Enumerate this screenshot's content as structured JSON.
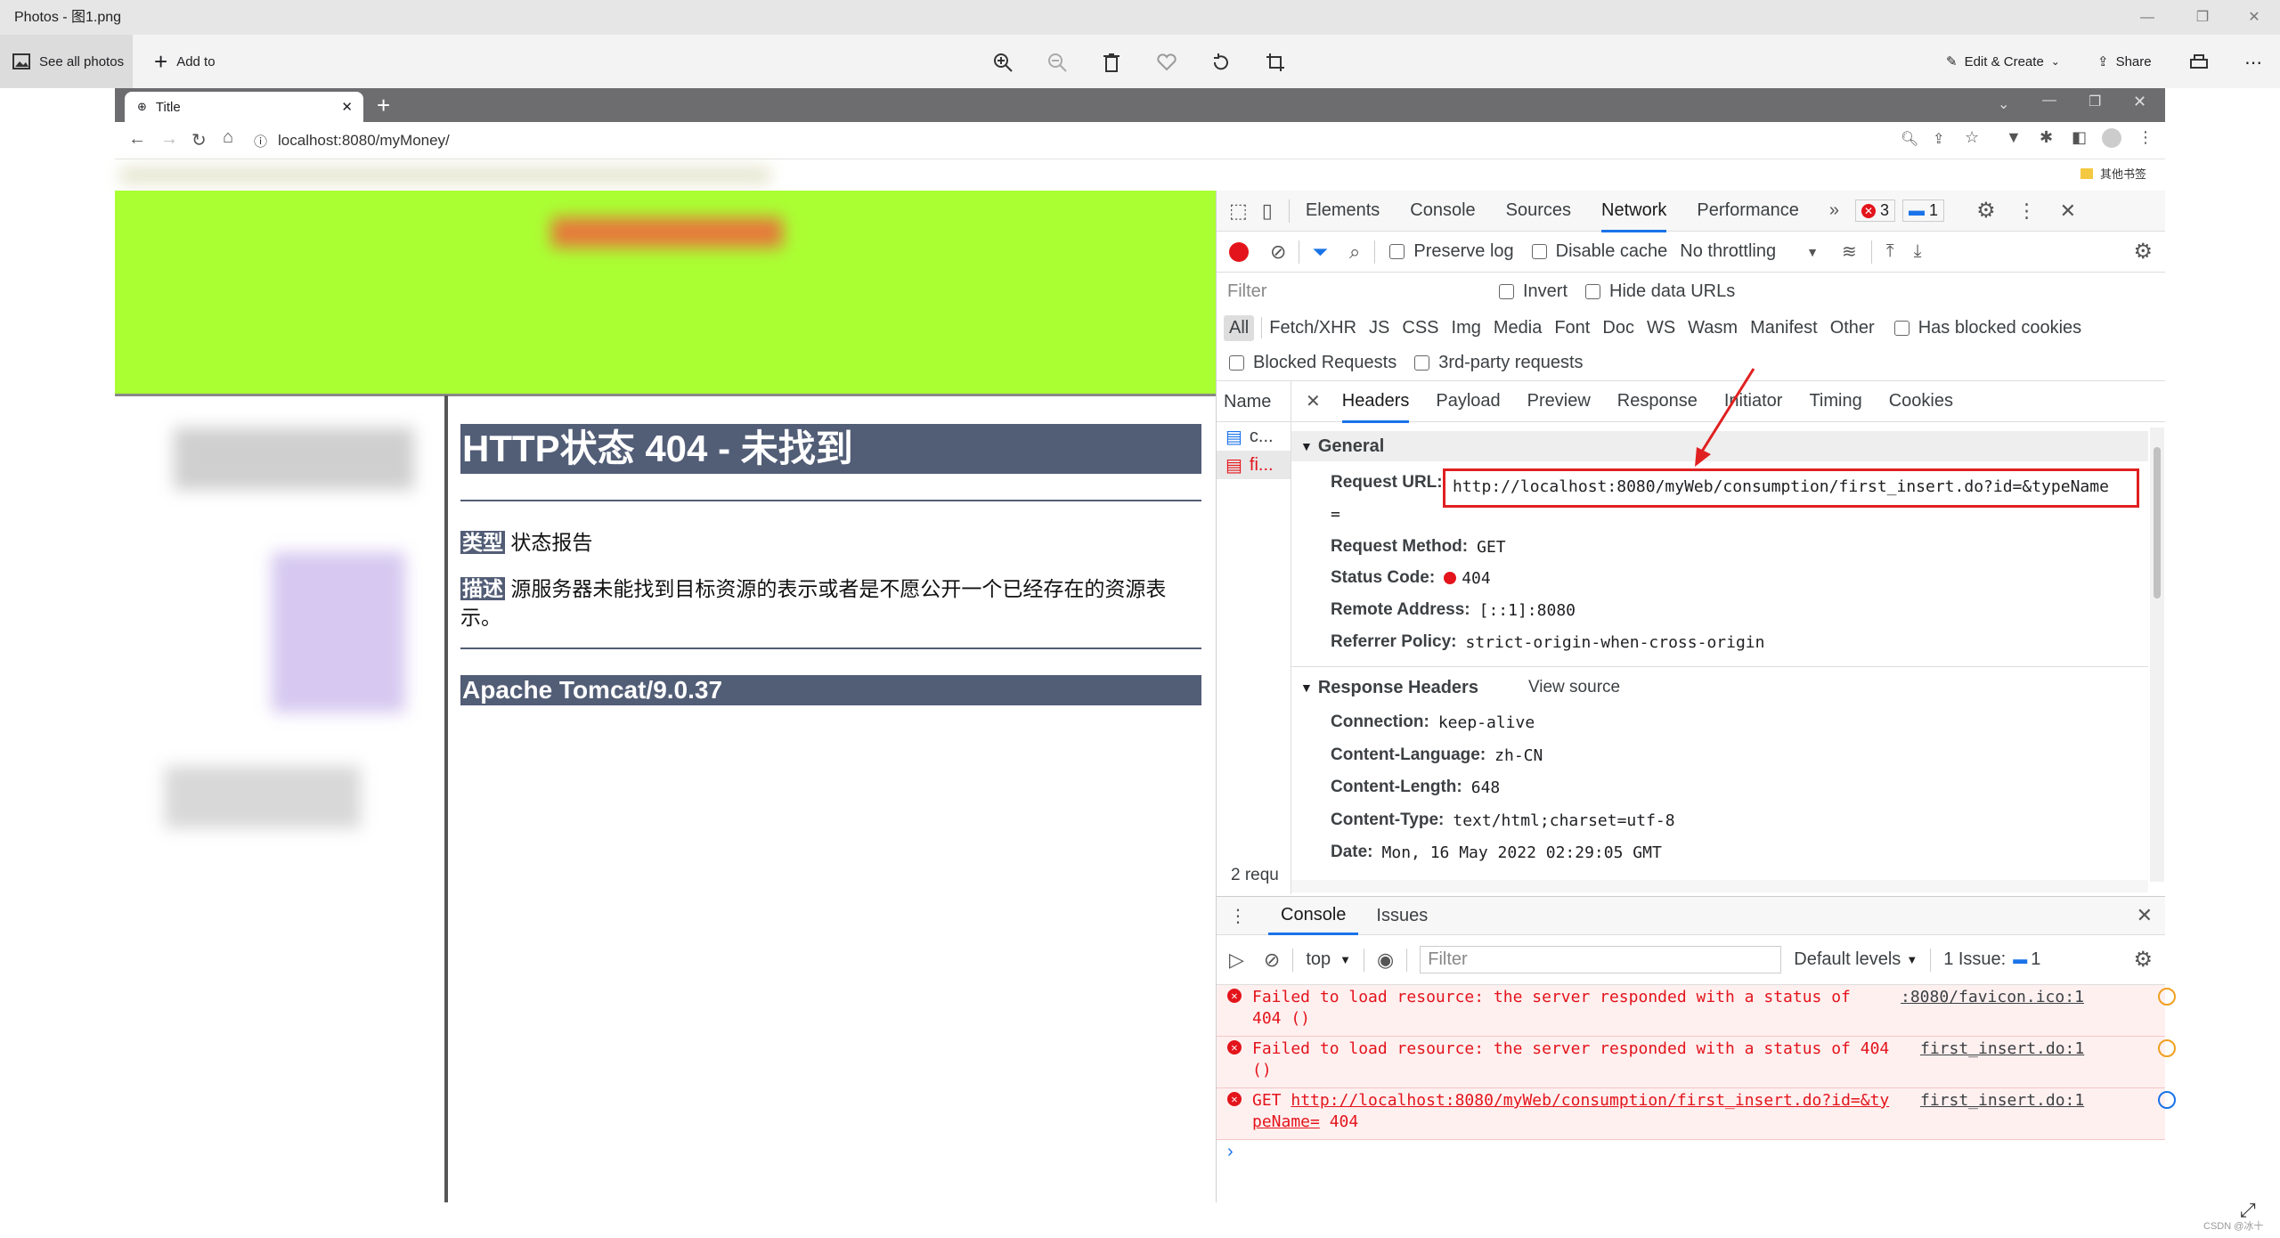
{
  "photos": {
    "title": "Photos - 图1.png",
    "see_all": "See all photos",
    "add_to": "Add to",
    "edit_create": "Edit & Create",
    "share": "Share"
  },
  "browser": {
    "tab_title": "Title",
    "url": "localhost:8080/myMoney/",
    "bookmark": "其他书签"
  },
  "page": {
    "error_title": "HTTP状态 404 - 未找到",
    "type_label": "类型",
    "type_value": "状态报告",
    "desc_label": "描述",
    "desc_value": "源服务器未能找到目标资源的表示或者是不愿公开一个已经存在的资源表示。",
    "footer": "Apache Tomcat/9.0.37"
  },
  "devtools": {
    "tabs": [
      "Elements",
      "Console",
      "Sources",
      "Network",
      "Performance"
    ],
    "active_tab": "Network",
    "error_count": "3",
    "message_count": "1",
    "toolbar": {
      "preserve_log": "Preserve log",
      "disable_cache": "Disable cache",
      "throttling": "No throttling"
    },
    "filter_placeholder": "Filter",
    "invert": "Invert",
    "hide_data_urls": "Hide data URLs",
    "type_filters": [
      "All",
      "Fetch/XHR",
      "JS",
      "CSS",
      "Img",
      "Media",
      "Font",
      "Doc",
      "WS",
      "Wasm",
      "Manifest",
      "Other"
    ],
    "has_blocked_cookies": "Has blocked cookies",
    "blocked_requests": "Blocked Requests",
    "third_party": "3rd-party requests",
    "name_col": "Name",
    "requests": [
      "c...",
      "fi..."
    ],
    "requests_status": "2 requ",
    "detail_tabs": [
      "Headers",
      "Payload",
      "Preview",
      "Response",
      "Initiator",
      "Timing",
      "Cookies"
    ],
    "general": {
      "title": "General",
      "request_url_key": "Request URL:",
      "request_url": "http://localhost:8080/myWeb/consumption/first_insert.do?id=&typeName",
      "request_url_cont": "=",
      "method_key": "Request Method:",
      "method": "GET",
      "status_key": "Status Code:",
      "status": "404",
      "remote_key": "Remote Address:",
      "remote": "[::1]:8080",
      "referrer_key": "Referrer Policy:",
      "referrer": "strict-origin-when-cross-origin"
    },
    "response_headers": {
      "title": "Response Headers",
      "view_source": "View source",
      "connection_key": "Connection:",
      "connection": "keep-alive",
      "lang_key": "Content-Language:",
      "lang": "zh-CN",
      "length_key": "Content-Length:",
      "length": "648",
      "type_key": "Content-Type:",
      "type": "text/html;charset=utf-8",
      "date_key": "Date:",
      "date": "Mon, 16 May 2022 02:29:05 GMT"
    }
  },
  "console": {
    "tabs": [
      "Console",
      "Issues"
    ],
    "context": "top",
    "filter_placeholder": "Filter",
    "levels": "Default levels",
    "issues": "1 Issue:",
    "issues_count": "1",
    "messages": [
      {
        "text1": "Failed to load resource: the server responded with a status of",
        "text2": "404 ()",
        "source": ":8080/favicon.ico:1"
      },
      {
        "text1": "Failed to load resource: the server responded with a status of 404",
        "text2": "()",
        "source": "first_insert.do:1"
      },
      {
        "text1_prefix": "GET",
        "text1": "http://localhost:8080/myWeb/consumption/first_insert.do?id=&ty",
        "text2": "peName=",
        "status": "404",
        "source": "first_insert.do:1"
      }
    ]
  },
  "watermark": "CSDN @冰十"
}
